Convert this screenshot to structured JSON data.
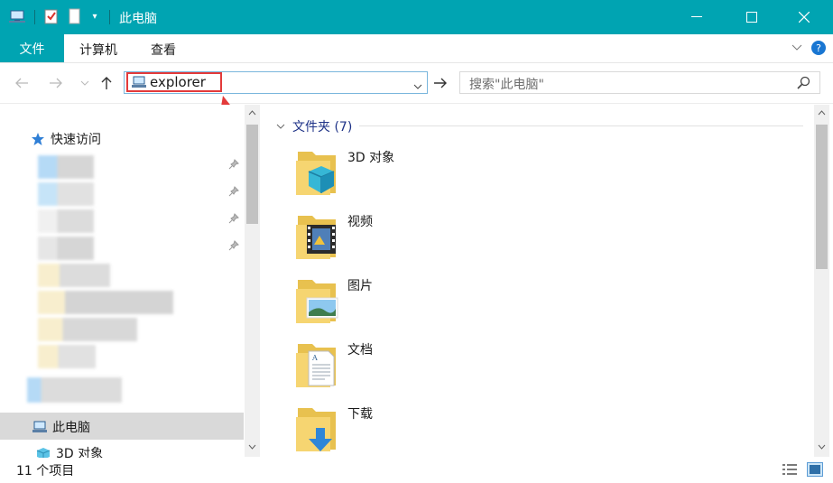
{
  "window": {
    "title": "此电脑"
  },
  "ribbon": {
    "tabs": [
      "文件",
      "计算机",
      "查看"
    ]
  },
  "address": {
    "path": "explorer"
  },
  "search": {
    "placeholder": "搜索\"此电脑\""
  },
  "nav": {
    "quick_access": "快速访问",
    "this_pc": "此电脑",
    "item_3d": "3D 对象"
  },
  "content": {
    "group_header": "文件夹 (7)",
    "folders": [
      {
        "name": "3D 对象",
        "icon": "3d-objects-folder-icon"
      },
      {
        "name": "视频",
        "icon": "videos-folder-icon"
      },
      {
        "name": "图片",
        "icon": "pictures-folder-icon"
      },
      {
        "name": "文档",
        "icon": "documents-folder-icon"
      },
      {
        "name": "下载",
        "icon": "downloads-folder-icon"
      }
    ]
  },
  "status": {
    "item_count": "11 个项目"
  },
  "colors": {
    "titlebar": "#00a4b2",
    "highlight": "#e33a3a",
    "accent_text": "#1e3287"
  }
}
